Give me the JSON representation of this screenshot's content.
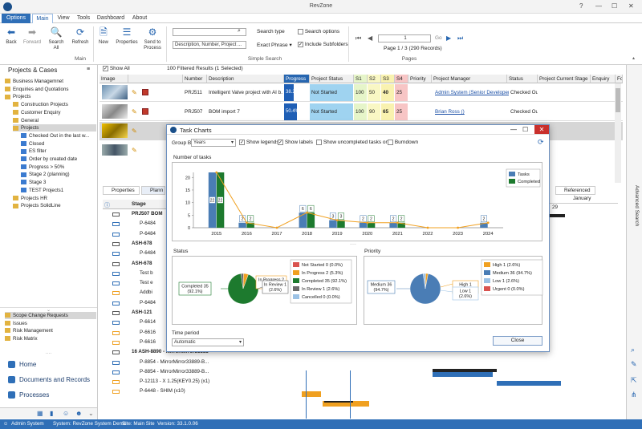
{
  "window": {
    "title": "RevZone"
  },
  "tabs": [
    {
      "label": "Options"
    },
    {
      "label": "Main"
    },
    {
      "label": "View"
    },
    {
      "label": "Tools"
    },
    {
      "label": "Dashboard"
    },
    {
      "label": "About"
    }
  ],
  "ribbon": {
    "main": {
      "back": "Back",
      "forward": "Forward",
      "search_all": "Search All",
      "refresh": "Refresh",
      "group": "Main"
    },
    "new": "New",
    "properties": "Properties",
    "send_to_process": "Send to Process",
    "search": {
      "search_type_label": "Search type",
      "fields_value": "Description, Number, Project ...",
      "exact_phrase": "Exact Phrase",
      "search_options": "Search options",
      "include_subfolders": "Include Subfolders",
      "group": "Simple Search"
    },
    "pages": {
      "page_value": "1",
      "go": "Go",
      "info": "Page 1 / 3 (290 Records)",
      "group": "Pages"
    }
  },
  "left_panel": {
    "title": "Projects & Cases",
    "tree": [
      {
        "label": "Business Managemnet",
        "level": 0
      },
      {
        "label": "Enquiries and Quotations",
        "level": 0
      },
      {
        "label": "Projects",
        "level": 0
      },
      {
        "label": "Construction Projects",
        "level": 1
      },
      {
        "label": "Customer Enquiry",
        "level": 1
      },
      {
        "label": "General",
        "level": 1
      },
      {
        "label": "Projects",
        "level": 1
      },
      {
        "label": "Checked Out in the last w...",
        "level": 2
      },
      {
        "label": "Closed",
        "level": 2
      },
      {
        "label": "ES filter",
        "level": 2
      },
      {
        "label": "Order by created date",
        "level": 2
      },
      {
        "label": "Progress > 50%",
        "level": 2
      },
      {
        "label": "Stage 2 (planning)",
        "level": 2
      },
      {
        "label": "Stage 3",
        "level": 2
      },
      {
        "label": "TEST Projects1",
        "level": 2
      },
      {
        "label": "Projects HR",
        "level": 1
      },
      {
        "label": "Projects SolidLine",
        "level": 1
      }
    ],
    "tree2": [
      {
        "label": "Scope Change Requests",
        "level": 0
      },
      {
        "label": "Issues",
        "level": 0
      },
      {
        "label": "Risk Management",
        "level": 0
      },
      {
        "label": "Risk Matrix",
        "level": 0
      }
    ],
    "nav": [
      {
        "label": "Home"
      },
      {
        "label": "Documents and Records"
      },
      {
        "label": "Processes"
      }
    ]
  },
  "grid": {
    "show_all": "Show All",
    "filtered": "100 Filtered Results (1 Selected)",
    "columns": [
      "Image",
      "",
      "Number",
      "Description",
      "Progress",
      "Project Status",
      "S1",
      "S2",
      "S3",
      "S4",
      "Priority",
      "Project Manager",
      "Status",
      "Project Current Stage",
      "Enquiry",
      "Fo"
    ],
    "rows": [
      {
        "number": "PRJ511",
        "description": "Intelligent Valve project with AI b...",
        "progress": "38.2%",
        "status": "Not Started",
        "s1": "100",
        "s2": "50",
        "s3": "40",
        "s4": "25",
        "manager": "Admin System (Senior Developer)",
        "state": "Checked Out"
      },
      {
        "number": "PRJ507",
        "description": "BOM import 7",
        "progress": "50.4%",
        "status": "Not Started",
        "s1": "100",
        "s2": "90",
        "s3": "65",
        "s4": "25",
        "manager": "Brian Ross ()",
        "state": "Checked Out"
      }
    ]
  },
  "lower": {
    "tabs": [
      "Properties",
      "Plann"
    ],
    "stage_header": "Stage",
    "referenced": "Referenced",
    "timeline": {
      "month": "January",
      "day": "29"
    },
    "stages": [
      "PRJ507 BOM",
      "P-6484",
      "P-6484",
      "ASH-678",
      "P-6484",
      "ASH-678",
      "Test b",
      "Test e",
      "Addbi",
      "P-6484",
      "ASH-121",
      "P-6614",
      "P-6616",
      "P-6616",
      "16     ASH-8890 - MirrorMirror33888",
      "P-8854 - MirrorMirror33889-B...",
      "P-8854 - MirrorMirror33889-B...",
      "P-12113 - X 1.25(KEY0.25) (x1)",
      "P-6448 - SHIM (x10)"
    ]
  },
  "dialog": {
    "title": "Task Charts",
    "group_by_label": "Group By",
    "group_by_value": "Years",
    "show_legends": "Show legends",
    "show_labels": "Show labels",
    "show_uncompleted": "Show uncompleted tasks only",
    "burndown": "Burndown",
    "tasks_title": "Number of tasks",
    "status_title": "Status",
    "priority_title": "Priority",
    "time_period_label": "Time period",
    "time_period_value": "Automatic",
    "close": "Close"
  },
  "chart_data": [
    {
      "type": "bar",
      "title": "Number of tasks",
      "categories": [
        "2015",
        "2016",
        "2017",
        "2018",
        "2019",
        "2020",
        "2021",
        "2022",
        "2023",
        "2024"
      ],
      "series": [
        {
          "name": "Tasks",
          "values": [
            22,
            2,
            0,
            6,
            3,
            2,
            2,
            0,
            0,
            2
          ],
          "color": "#4a7db5"
        },
        {
          "name": "Completed",
          "values": [
            22,
            2,
            0,
            6,
            3,
            2,
            2,
            0,
            0,
            0
          ],
          "color": "#1d7a2e"
        }
      ],
      "line": {
        "name": "Completed trend",
        "values": [
          22,
          2,
          0,
          6,
          3,
          2,
          2,
          0,
          0,
          2
        ],
        "color": "#f0a020"
      },
      "ylim": [
        0,
        22
      ],
      "yticks": [
        0,
        5,
        10,
        15,
        20
      ],
      "legend": "right",
      "grid": false
    },
    {
      "type": "pie",
      "title": "Status",
      "slices": [
        {
          "label": "Not Started 0 (0.0%)",
          "value": 0,
          "color": "#d9534f"
        },
        {
          "label": "In Progress 2 (5.3%)",
          "value": 2,
          "color": "#f0a020"
        },
        {
          "label": "Completed 35 (92.1%)",
          "value": 35,
          "color": "#1d7a2e"
        },
        {
          "label": "In Review 1 (2.6%)",
          "value": 1,
          "color": "#6b6b6b"
        },
        {
          "label": "Cancelled 0 (0.0%)",
          "value": 0,
          "color": "#9cc2e5"
        }
      ],
      "callouts": [
        "Completed 35 (92.1%)",
        "In Progress 2 (5.3%)",
        "In Review 1 (2.6%)"
      ],
      "legend": "right"
    },
    {
      "type": "pie",
      "title": "Priority",
      "slices": [
        {
          "label": "High 1 (2.6%)",
          "value": 1,
          "color": "#f0a020"
        },
        {
          "label": "Medium 36 (94.7%)",
          "value": 36,
          "color": "#4a7db5"
        },
        {
          "label": "Low 1 (2.6%)",
          "value": 1,
          "color": "#9cc2e5"
        },
        {
          "label": "Urgent 0 (0.0%)",
          "value": 0,
          "color": "#d9534f"
        }
      ],
      "callouts": [
        "Medium 36 (94.7%)",
        "High 1 (2.6%)",
        "Low 1 (2.6%)"
      ],
      "legend": "right"
    }
  ],
  "statusbar": {
    "user": "Admin System",
    "system": "System: RevZone System Demo",
    "site": "Site: Main Site",
    "version": "Version: 33.1.0.06"
  },
  "right_strip": {
    "label": "Advanced Search"
  }
}
